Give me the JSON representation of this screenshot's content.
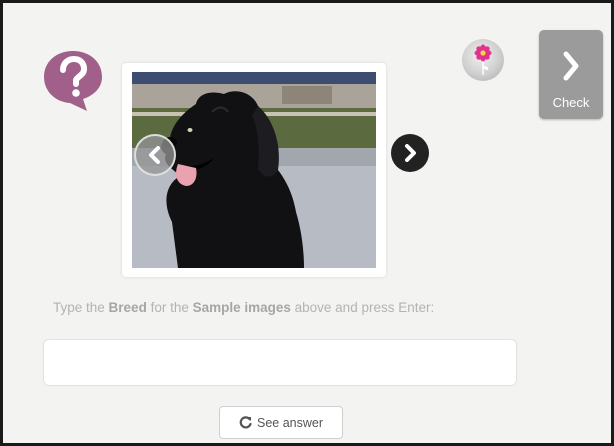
{
  "quiz": {
    "prompt_pre": "Type the ",
    "prompt_bold1": "Breed",
    "prompt_mid": " for the ",
    "prompt_bold2": "Sample images",
    "prompt_post": " above and press Enter:",
    "answer_value": "",
    "answer_placeholder": "",
    "see_answer_label": "See answer",
    "check_label": "Check"
  },
  "icons": {
    "help": "question-mark-icon",
    "prev": "chevron-left-icon",
    "next": "chevron-right-icon",
    "check": "chevron-right-icon",
    "see_answer": "refresh-icon",
    "badge": "flower-icon"
  },
  "colors": {
    "frame_background": "#f3f3f1",
    "help_bubble": "#a0608a",
    "check_button": "#9b9b9b",
    "next_button": "#222222",
    "flower": "#e0338c"
  },
  "carousel": {
    "image_subject": "black dog"
  }
}
